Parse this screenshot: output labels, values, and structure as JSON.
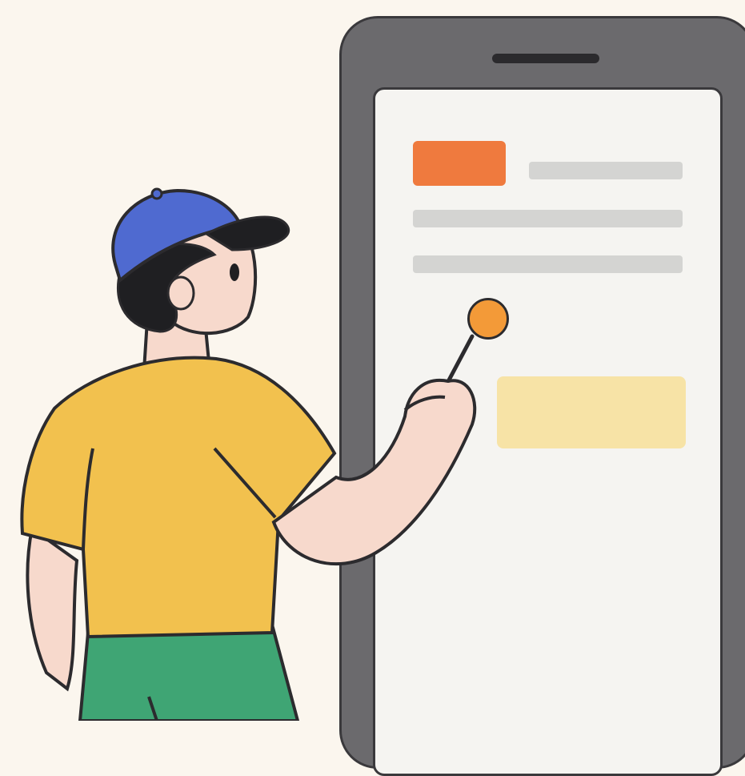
{
  "scene": {
    "illustration": "person-pointing-at-phone",
    "colors": {
      "background": "#fbf6ee",
      "phone_frame": "#6b6a6d",
      "screen": "#f5f4f1",
      "accent_chip": "#ef7a3e",
      "placeholder_line": "#d4d4d2",
      "highlight_card": "#f7e3a6",
      "tap_indicator": "#f39a38",
      "cap": "#4f6ad0",
      "shirt": "#f2c14e",
      "pants": "#3fa574",
      "skin": "#f7d9cc",
      "hair": "#1f1f22"
    }
  }
}
